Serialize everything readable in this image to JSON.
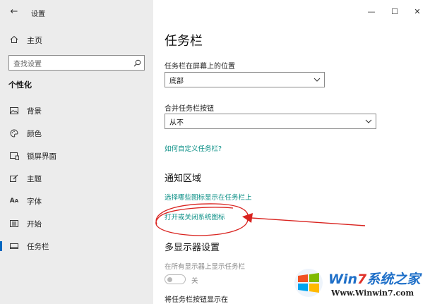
{
  "window": {
    "title": "设置",
    "back_icon": "back-arrow-icon",
    "controls": {
      "minimize": "—",
      "maximize": "☐",
      "close": "✕"
    }
  },
  "sidebar": {
    "home_label": "主页",
    "search_placeholder": "查找设置",
    "section_title": "个性化",
    "items": [
      {
        "label": "背景",
        "icon": "picture-icon"
      },
      {
        "label": "颜色",
        "icon": "palette-icon"
      },
      {
        "label": "锁屏界面",
        "icon": "lockscreen-icon"
      },
      {
        "label": "主题",
        "icon": "brush-icon"
      },
      {
        "label": "字体",
        "icon": "font-icon"
      },
      {
        "label": "开始",
        "icon": "start-icon"
      },
      {
        "label": "任务栏",
        "icon": "taskbar-icon",
        "active": true
      }
    ],
    "accent_color": "#0067c0"
  },
  "main": {
    "page_title": "任务栏",
    "position_label": "任务栏在屏幕上的位置",
    "position_value": "底部",
    "merge_label": "合并任务栏按钮",
    "merge_value": "从不",
    "customize_link": "如何自定义任务栏?",
    "notification_title": "通知区域",
    "select_icons_link": "选择哪些图标显示在任务栏上",
    "system_icons_link": "打开或关闭系统图标",
    "multi_display_title": "多显示器设置",
    "show_all_label": "在所有显示器上显示任务栏",
    "show_all_toggle": "关",
    "show_buttons_label": "将任务栏按钮显示在",
    "link_color": "#0a8f86"
  },
  "watermark": {
    "brand_prefix": "Win",
    "brand_num": "7",
    "brand_suffix": "系统之家",
    "url": "Www.Winwin7.com"
  }
}
